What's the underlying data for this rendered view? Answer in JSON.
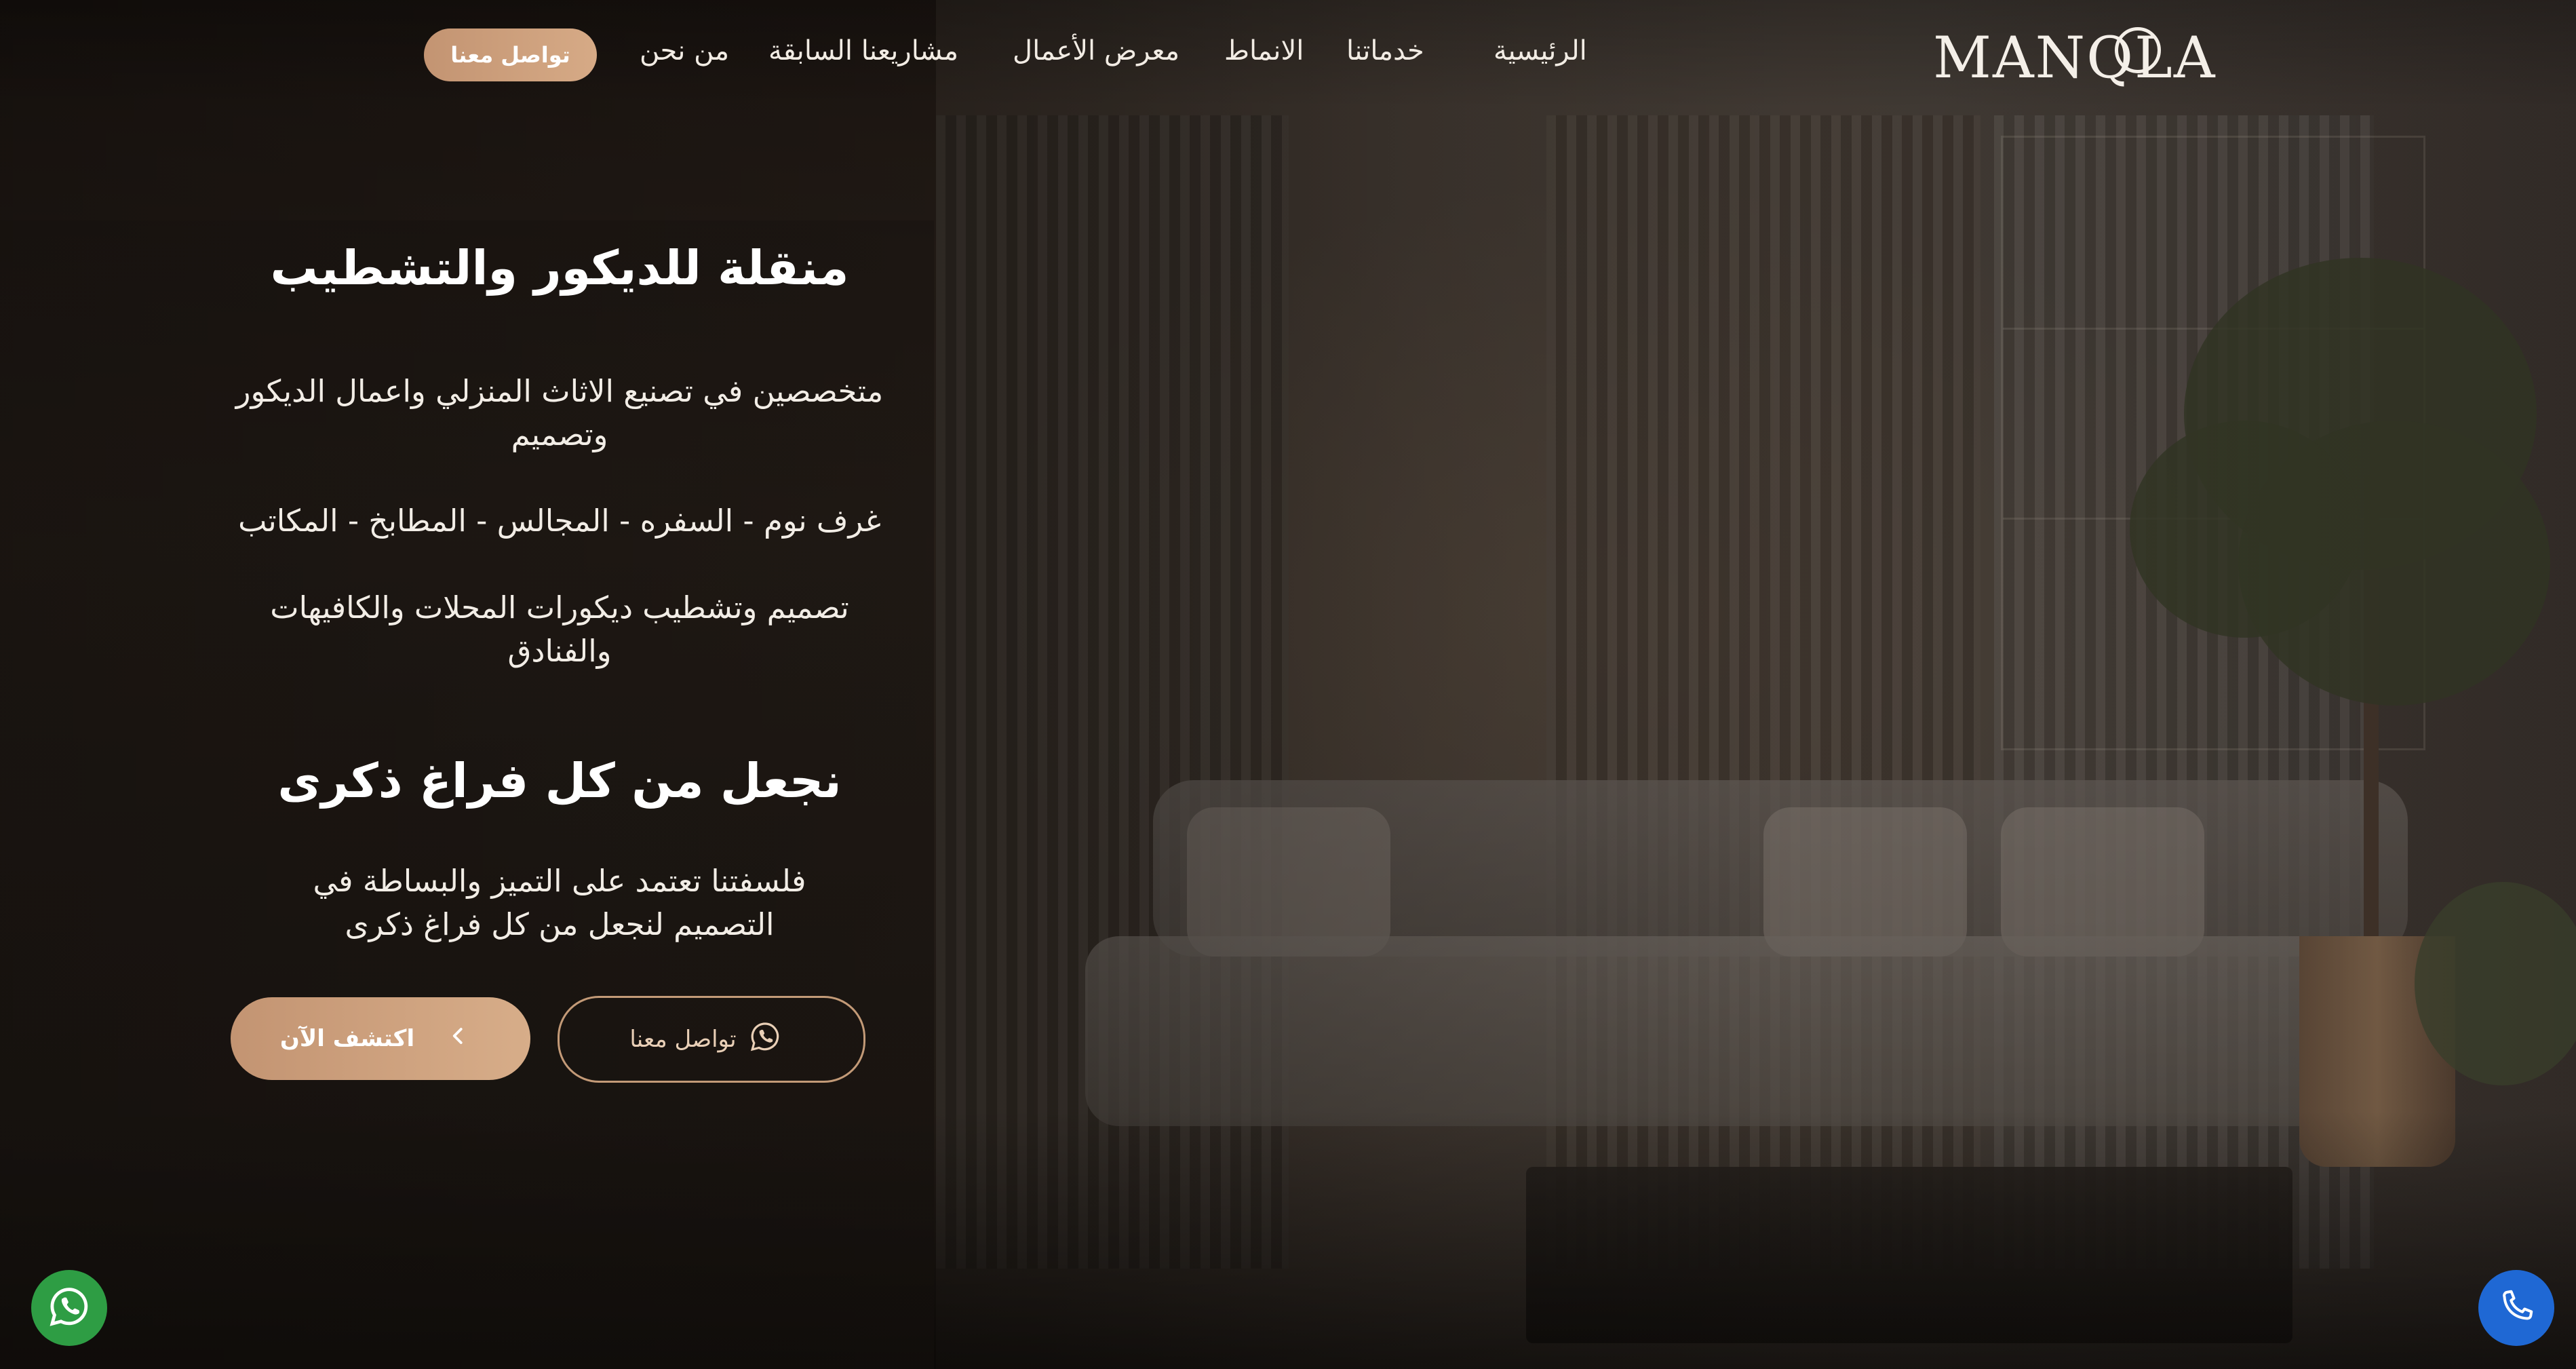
{
  "brand": {
    "logo_text": "MANQLA"
  },
  "nav": {
    "items": [
      "الرئيسية",
      "خدماتنا",
      "الانماط",
      "معرض الأعمال",
      "مشاريعنا السابقة",
      "من نحن"
    ],
    "cta": "تواصل معنا"
  },
  "hero": {
    "title": "منقلة للديكور والتشطيب",
    "line1": "متخصصين في تصنيع الاثاث المنزلي واعمال الديكور وتصميم",
    "line2": "غرف نوم - السفره - المجالس - المطابخ - المكاتب",
    "line3": "تصميم وتشطيب ديكورات المحلات والكافيهات والفنادق",
    "subtitle": "نجعل من كل فراغ ذكرى",
    "philosophy": "فلسفتنا تعتمد على التميز والبساطة في التصميم لنجعل من كل فراغ ذكرى",
    "btn_contact": "تواصل معنا",
    "btn_explore": "اكتشف الآن"
  },
  "colors": {
    "accent": "#c9a07c",
    "whatsapp": "#2e9d44",
    "call": "#1f68d4"
  },
  "icons": {
    "contact_button": "whatsapp-icon",
    "explore_button": "chevron-left-icon",
    "fab_left": "whatsapp-icon",
    "fab_right": "phone-icon"
  }
}
